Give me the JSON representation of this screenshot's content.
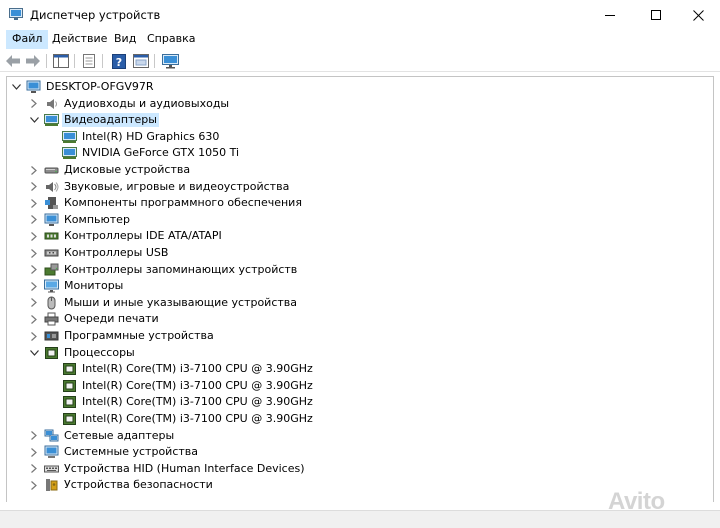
{
  "window": {
    "title": "Диспетчер устройств"
  },
  "menu": [
    {
      "label": "Файл",
      "active": true
    },
    {
      "label": "Действие",
      "active": false
    },
    {
      "label": "Вид",
      "active": false
    },
    {
      "label": "Справка",
      "active": false
    }
  ],
  "tree": {
    "root": "DESKTOP-OFGV97R",
    "items": [
      {
        "label": "Аудиовходы и аудиовыходы",
        "icon": "speaker-icon",
        "expanded": false,
        "children": []
      },
      {
        "label": "Видеоадаптеры",
        "icon": "display-adapter-icon",
        "expanded": true,
        "selected": true,
        "children": [
          {
            "label": "Intel(R) HD Graphics 630",
            "icon": "display-adapter-icon"
          },
          {
            "label": "NVIDIA GeForce GTX 1050 Ti",
            "icon": "display-adapter-icon"
          }
        ]
      },
      {
        "label": "Дисковые устройства",
        "icon": "disk-drive-icon",
        "expanded": false,
        "children": []
      },
      {
        "label": "Звуковые, игровые и видеоустройства",
        "icon": "sound-icon",
        "expanded": false,
        "children": []
      },
      {
        "label": "Компоненты программного обеспечения",
        "icon": "software-component-icon",
        "expanded": false,
        "children": []
      },
      {
        "label": "Компьютер",
        "icon": "computer-icon",
        "expanded": false,
        "children": []
      },
      {
        "label": "Контроллеры IDE ATA/ATAPI",
        "icon": "ide-controller-icon",
        "expanded": false,
        "children": []
      },
      {
        "label": "Контроллеры USB",
        "icon": "usb-icon",
        "expanded": false,
        "children": []
      },
      {
        "label": "Контроллеры запоминающих устройств",
        "icon": "storage-controller-icon",
        "expanded": false,
        "children": []
      },
      {
        "label": "Мониторы",
        "icon": "monitor-icon",
        "expanded": false,
        "children": []
      },
      {
        "label": "Мыши и иные указывающие устройства",
        "icon": "mouse-icon",
        "expanded": false,
        "children": []
      },
      {
        "label": "Очереди печати",
        "icon": "printer-icon",
        "expanded": false,
        "children": []
      },
      {
        "label": "Программные устройства",
        "icon": "software-device-icon",
        "expanded": false,
        "children": []
      },
      {
        "label": "Процессоры",
        "icon": "processor-icon",
        "expanded": true,
        "children": [
          {
            "label": "Intel(R) Core(TM) i3-7100 CPU @ 3.90GHz",
            "icon": "processor-icon"
          },
          {
            "label": "Intel(R) Core(TM) i3-7100 CPU @ 3.90GHz",
            "icon": "processor-icon"
          },
          {
            "label": "Intel(R) Core(TM) i3-7100 CPU @ 3.90GHz",
            "icon": "processor-icon"
          },
          {
            "label": "Intel(R) Core(TM) i3-7100 CPU @ 3.90GHz",
            "icon": "processor-icon"
          }
        ]
      },
      {
        "label": "Сетевые адаптеры",
        "icon": "network-adapter-icon",
        "expanded": false,
        "children": []
      },
      {
        "label": "Системные устройства",
        "icon": "system-device-icon",
        "expanded": false,
        "children": []
      },
      {
        "label": "Устройства HID (Human Interface Devices)",
        "icon": "hid-icon",
        "expanded": false,
        "children": []
      },
      {
        "label": "Устройства безопасности",
        "icon": "security-device-icon",
        "expanded": false,
        "children": []
      }
    ]
  },
  "watermark": "Avito",
  "colors": {
    "selection": "#cce8ff",
    "toolbar_blue": "#2a5da8",
    "screen_blue": "#3a8fd6",
    "chip_green": "#4b7a30"
  }
}
